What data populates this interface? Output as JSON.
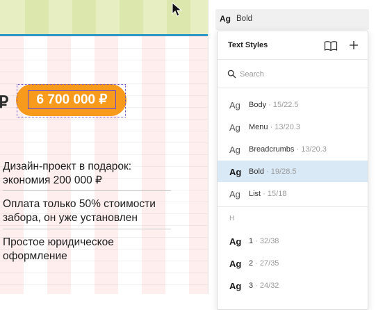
{
  "canvas": {
    "price": "6 700 000 ₽",
    "ruble_fragment": "₽",
    "features": [
      "Дизайн-проект в подарок: экономия 200 000 ₽",
      "Оплата только 50% стоимости забора, он уже установлен",
      "Простое юридическое оформление"
    ]
  },
  "panel": {
    "current_style": {
      "ag": "Ag",
      "name": "Bold"
    },
    "popup": {
      "title": "Text Styles",
      "search_placeholder": "Search",
      "styles": [
        {
          "ag": "Ag",
          "name": "Body",
          "meta": " · 15/22.5"
        },
        {
          "ag": "Ag",
          "name": "Menu",
          "meta": " · 13/20.3"
        },
        {
          "ag": "Ag",
          "name": "Breadcrumbs",
          "meta": " · 13/20.3"
        },
        {
          "ag": "Ag",
          "name": "Bold",
          "meta": " · 19/28.5"
        },
        {
          "ag": "Ag",
          "name": "List",
          "meta": " · 15/18"
        }
      ],
      "group_heading": "H",
      "headings": [
        {
          "ag": "Ag",
          "name": "1",
          "meta": " · 32/38"
        },
        {
          "ag": "Ag",
          "name": "2",
          "meta": " · 27/35"
        },
        {
          "ag": "Ag",
          "name": "3",
          "meta": " · 24/32"
        }
      ],
      "selected_style": "Bold"
    }
  },
  "colors": {
    "accent_orange": "#f89a1c",
    "selection_blue": "#dae9f6",
    "rule_blue": "#2e98c9"
  },
  "icons": {
    "library": "book-open-icon",
    "add": "plus-icon",
    "search": "search-icon",
    "cursor": "mouse-pointer-icon"
  }
}
